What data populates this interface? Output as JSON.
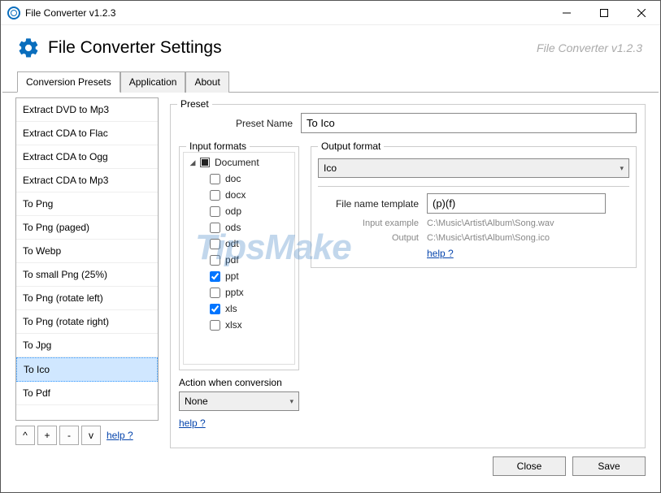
{
  "window": {
    "title": "File Converter v1.2.3"
  },
  "header": {
    "title": "File Converter Settings",
    "brand": "File Converter v1.2.3"
  },
  "tabs": [
    "Conversion Presets",
    "Application",
    "About"
  ],
  "activeTab": 0,
  "presets": {
    "items": [
      "Extract DVD to Mp3",
      "Extract CDA to Flac",
      "Extract CDA to Ogg",
      "Extract CDA to Mp3",
      "To Png",
      "To Png (paged)",
      "To Webp",
      "To small Png (25%)",
      "To Png (rotate left)",
      "To Png (rotate right)",
      "To Jpg",
      "To Ico",
      "To Pdf"
    ],
    "selectedIndex": 11,
    "buttons": {
      "up": "^",
      "add": "+",
      "remove": "-",
      "down": "v"
    },
    "help": "help ?"
  },
  "preset_group": {
    "legend": "Preset",
    "name_label": "Preset Name",
    "name_value": "To Ico",
    "input_formats": {
      "legend": "Input formats",
      "root": "Document",
      "items": [
        {
          "label": "doc",
          "checked": false
        },
        {
          "label": "docx",
          "checked": false
        },
        {
          "label": "odp",
          "checked": false
        },
        {
          "label": "ods",
          "checked": false
        },
        {
          "label": "odt",
          "checked": false
        },
        {
          "label": "pdf",
          "checked": false
        },
        {
          "label": "ppt",
          "checked": true
        },
        {
          "label": "pptx",
          "checked": false
        },
        {
          "label": "xls",
          "checked": true
        },
        {
          "label": "xlsx",
          "checked": false
        }
      ]
    },
    "action_label": "Action when conversion",
    "action_value": "None",
    "help": "help ?",
    "output_format": {
      "legend": "Output format",
      "value": "Ico",
      "file_template_label": "File name template",
      "file_template_value": "(p)(f)",
      "input_example_label": "Input example",
      "input_example_value": "C:\\Music\\Artist\\Album\\Song.wav",
      "output_label": "Output",
      "output_value": "C:\\Music\\Artist\\Album\\Song.ico",
      "help": "help ?"
    }
  },
  "buttons": {
    "close": "Close",
    "save": "Save"
  },
  "watermark": "TipsMake"
}
